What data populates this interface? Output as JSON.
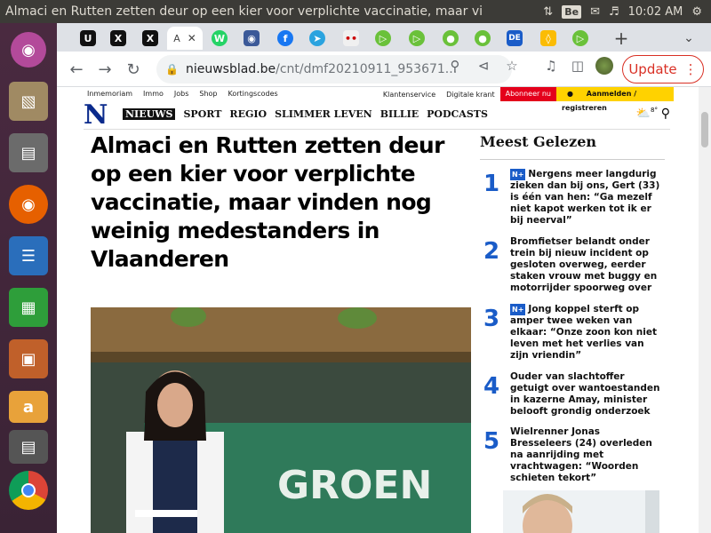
{
  "window": {
    "title": "Almaci en Rutten zetten deur op een kier voor verplichte vaccinatie, maar vi",
    "clock": "10:02 AM",
    "keyboard_indicator": "Be"
  },
  "launcher": {
    "apps": [
      "ubuntu-icon",
      "files-icon",
      "file-cabinet-icon",
      "firefox-icon",
      "writer-icon",
      "calc-icon",
      "impress-icon",
      "amazon-icon",
      "stack-icon",
      "chrome-icon"
    ]
  },
  "tabs": {
    "favicons": [
      "U",
      "X",
      "X",
      "/",
      "W",
      "◉",
      "f",
      "➤",
      "••",
      "▷",
      "▷",
      "●",
      "●",
      "DE",
      "◊",
      "▷"
    ],
    "active_label": "A",
    "new_tab": "+",
    "tab_search": "⌄"
  },
  "toolbar": {
    "url_host": "nieuwsblad.be",
    "url_path": "/cnt/dmf20210911_953671...",
    "update_label": "Update"
  },
  "site": {
    "util_links": [
      "Inmemoriam",
      "Immo",
      "Jobs",
      "Shop",
      "Kortingscodes"
    ],
    "util_right": [
      "Klantenservice",
      "Digitale krant"
    ],
    "subscribe": "Abonneer nu",
    "login": "Aanmelden / registreren",
    "logo": "N",
    "nav": [
      "NIEUWS",
      "SPORT",
      "REGIO",
      "SLIMMER LEVEN",
      "BILLIE",
      "PODCASTS"
    ],
    "weather_temp": "8°"
  },
  "article": {
    "headline": "Almaci en Rutten zetten deur op een kier voor verplichte vaccinatie, maar vinden nog weinig medestanders in Vlaanderen",
    "banner_text": "GROEN"
  },
  "most_read": {
    "title": "Meest Gelezen",
    "plus_badge": "N+",
    "items": [
      {
        "num": "1",
        "plus": true,
        "text": "Nergens meer langdurig zieken dan bij ons, Gert (33) is één van hen: “Ga mezelf niet kapot werken tot ik er bij neerval”"
      },
      {
        "num": "2",
        "plus": false,
        "text": "Bromfietser belandt onder trein bij nieuw incident op gesloten overweg, eerder staken vrouw met buggy en motorrijder spoorweg over"
      },
      {
        "num": "3",
        "plus": true,
        "text": "Jong koppel sterft op amper twee weken van elkaar: “Onze zoon kon niet leven met het verlies van zijn vriendin”"
      },
      {
        "num": "4",
        "plus": false,
        "text": "Ouder van slachtoffer getuigt over wantoestanden in kazerne Amay, minister belooft grondig onderzoek"
      },
      {
        "num": "5",
        "plus": false,
        "text": "Wielrenner Jonas Bresseleers (24) overleden na aanrijding met vrachtwagen: “Woorden schieten tekort”"
      }
    ]
  },
  "colors": {
    "accent_blue": "#1a5cc8",
    "logo_blue": "#0a2a8c",
    "subscribe_red": "#e4001b",
    "login_yellow": "#ffd200",
    "update_red": "#d93025"
  }
}
